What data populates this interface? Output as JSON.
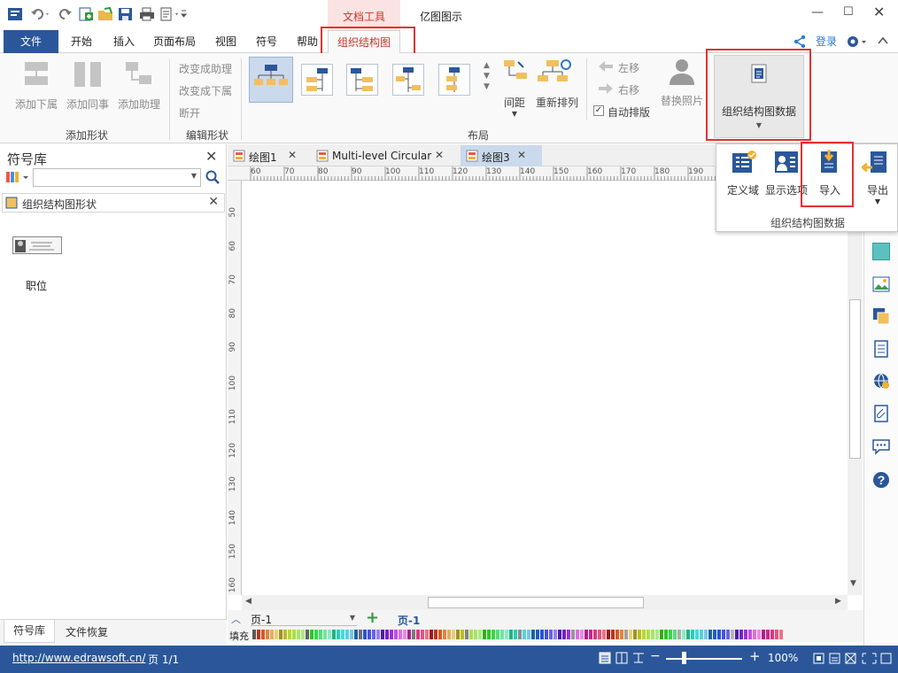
{
  "titlebar": {
    "context_tab": "文档工具",
    "app_title": "亿图图示"
  },
  "tabs": {
    "file": "文件",
    "home": "开始",
    "insert": "插入",
    "page_layout": "页面布局",
    "view": "视图",
    "symbol": "符号",
    "help": "帮助",
    "org_chart": "组织结构图"
  },
  "account": {
    "login": "登录"
  },
  "ribbon": {
    "add_sub": "添加下属",
    "add_colleague": "添加同事",
    "add_assistant": "添加助理",
    "group_add_shape": "添加形状",
    "change_to_assistant": "改变成助理",
    "change_to_sub": "改变成下属",
    "disconnect": "断开",
    "group_edit_shape": "编辑形状",
    "spacing": "间距",
    "rearrange": "重新排列",
    "move_left": "左移",
    "move_right": "右移",
    "auto_layout": "自动排版",
    "group_layout": "布局",
    "replace_photo": "替换照片",
    "org_data": "组织结构图数据"
  },
  "popup": {
    "define_field": "定义域",
    "display_options": "显示选项",
    "import": "导入",
    "export": "导出",
    "group_label": "组织结构图数据"
  },
  "library": {
    "title": "符号库",
    "section": "组织结构图形状",
    "shape_label": "职位",
    "search_placeholder": ""
  },
  "doc_tabs": [
    "绘图1",
    "Multi-level Circular",
    "绘图3"
  ],
  "ruler": {
    "h_ticks": [
      "60",
      "70",
      "80",
      "90",
      "100",
      "110",
      "120",
      "130",
      "140",
      "150",
      "160",
      "170",
      "180",
      "190"
    ],
    "v_ticks": [
      "50",
      "60",
      "70",
      "80",
      "90",
      "100",
      "110",
      "120",
      "130",
      "140",
      "150",
      "160"
    ]
  },
  "pagebar": {
    "page_select": "页-1",
    "page_tab": "页-1",
    "fill_label": "填充"
  },
  "bottom_tabs": {
    "symbol_lib": "符号库",
    "file_recovery": "文件恢复"
  },
  "status": {
    "url": "http://www.edrawsoft.cn/",
    "page_info": "页 1/1",
    "zoom": "100%"
  },
  "colors": {
    "accent_blue": "#2b579a",
    "highlight_red": "#e53030",
    "org_tab_text": "#c0392b"
  }
}
